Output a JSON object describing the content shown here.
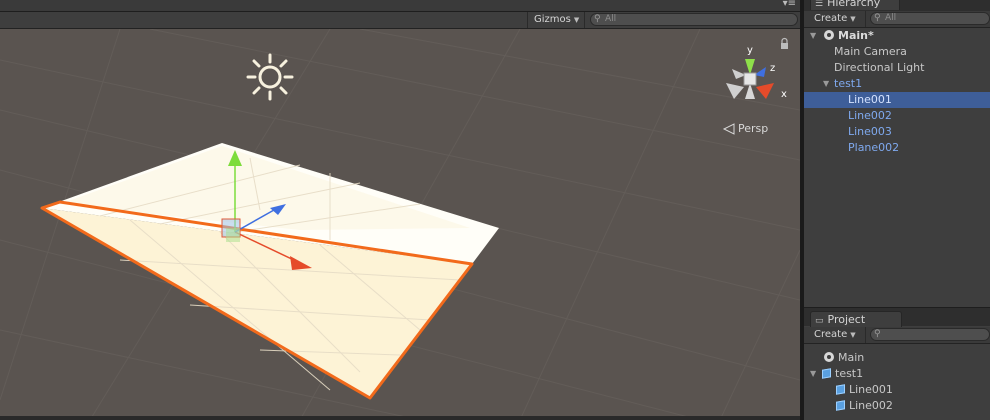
{
  "scene": {
    "panel_menu": "▾≡",
    "gizmos_label": "Gizmos",
    "search_placeholder": "All",
    "persp_label": "Persp",
    "axis_labels": {
      "y": "y",
      "z": "z",
      "x": "x"
    }
  },
  "hierarchy": {
    "tab_label": "Hierarchy",
    "create_label": "Create",
    "search_placeholder": "All",
    "scene_name": "Main*",
    "items": [
      {
        "label": "Main Camera",
        "indent": 1
      },
      {
        "label": "Directional Light",
        "indent": 1
      },
      {
        "label": "test1",
        "indent": 1,
        "prefab": true,
        "expanded": true
      },
      {
        "label": "Line001",
        "indent": 2,
        "prefab": true,
        "selected": true
      },
      {
        "label": "Line002",
        "indent": 2,
        "prefab": true
      },
      {
        "label": "Line003",
        "indent": 2,
        "prefab": true
      },
      {
        "label": "Plane002",
        "indent": 2,
        "prefab": true
      }
    ]
  },
  "project": {
    "tab_label": "Project",
    "create_label": "Create",
    "items": [
      {
        "label": "Main",
        "icon": "unity-scene-icon"
      },
      {
        "label": "test1",
        "icon": "model-icon",
        "expanded": true
      },
      {
        "label": "Line001",
        "icon": "mesh-icon"
      },
      {
        "label": "Line002",
        "icon": "mesh-icon"
      }
    ]
  },
  "colors": {
    "selection": "#3e5e99",
    "prefab_text": "#7fa9ee",
    "outline_orange": "#f26a1b",
    "gizmo_green": "#7ddc3c",
    "gizmo_red": "#e54b2a",
    "gizmo_blue": "#3f6fe0"
  }
}
